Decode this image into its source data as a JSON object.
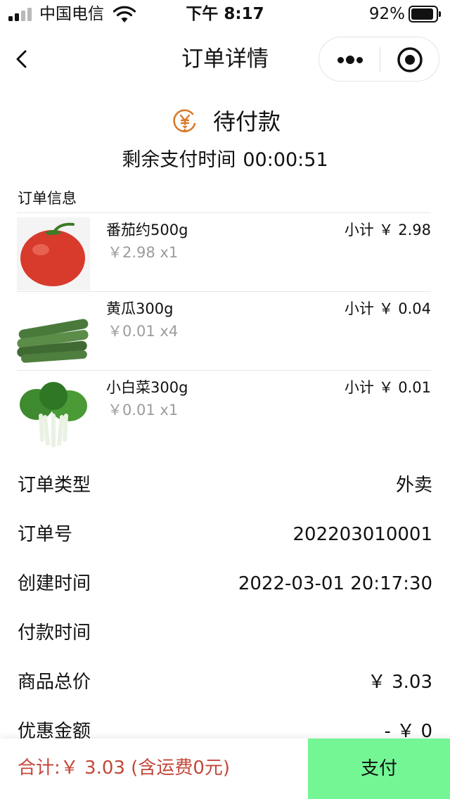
{
  "status_bar": {
    "carrier": "中国电信",
    "time": "下午 8:17",
    "battery": "92%",
    "battery_level": 0.92
  },
  "nav": {
    "title": "订单详情"
  },
  "order_status": {
    "text": "待付款",
    "icon": "yen-hourglass-icon",
    "countdown_label": "剩余支付时间",
    "countdown_value": "00:00:51"
  },
  "section_label": "订单信息",
  "items": [
    {
      "name": "番茄约500g",
      "price": "￥2.98 x1",
      "subtotal": "小计 ￥ 2.98",
      "image": "tomato"
    },
    {
      "name": "黄瓜300g",
      "price": "￥0.01 x4",
      "subtotal": "小计 ￥ 0.04",
      "image": "cucumber"
    },
    {
      "name": "小白菜300g",
      "price": "￥0.01 x1",
      "subtotal": "小计 ￥ 0.01",
      "image": "bok-choy"
    }
  ],
  "info_rows": [
    {
      "label": "订单类型",
      "value": "外卖"
    },
    {
      "label": "订单号",
      "value": "202203010001"
    },
    {
      "label": "创建时间",
      "value": "2022-03-01 20:17:30"
    },
    {
      "label": "付款时间",
      "value": ""
    },
    {
      "label": "商品总价",
      "value": "￥ 3.03"
    },
    {
      "label": "优惠金额",
      "value": "- ￥ 0"
    }
  ],
  "bottom_bar": {
    "total": "合计:￥ 3.03 (含运费0元)",
    "pay_label": "支付"
  },
  "colors": {
    "accent_orange": "#d97a2b",
    "total_red": "#c4473a",
    "pay_button_green": "#74f695",
    "muted_text": "#9c9c9c"
  }
}
